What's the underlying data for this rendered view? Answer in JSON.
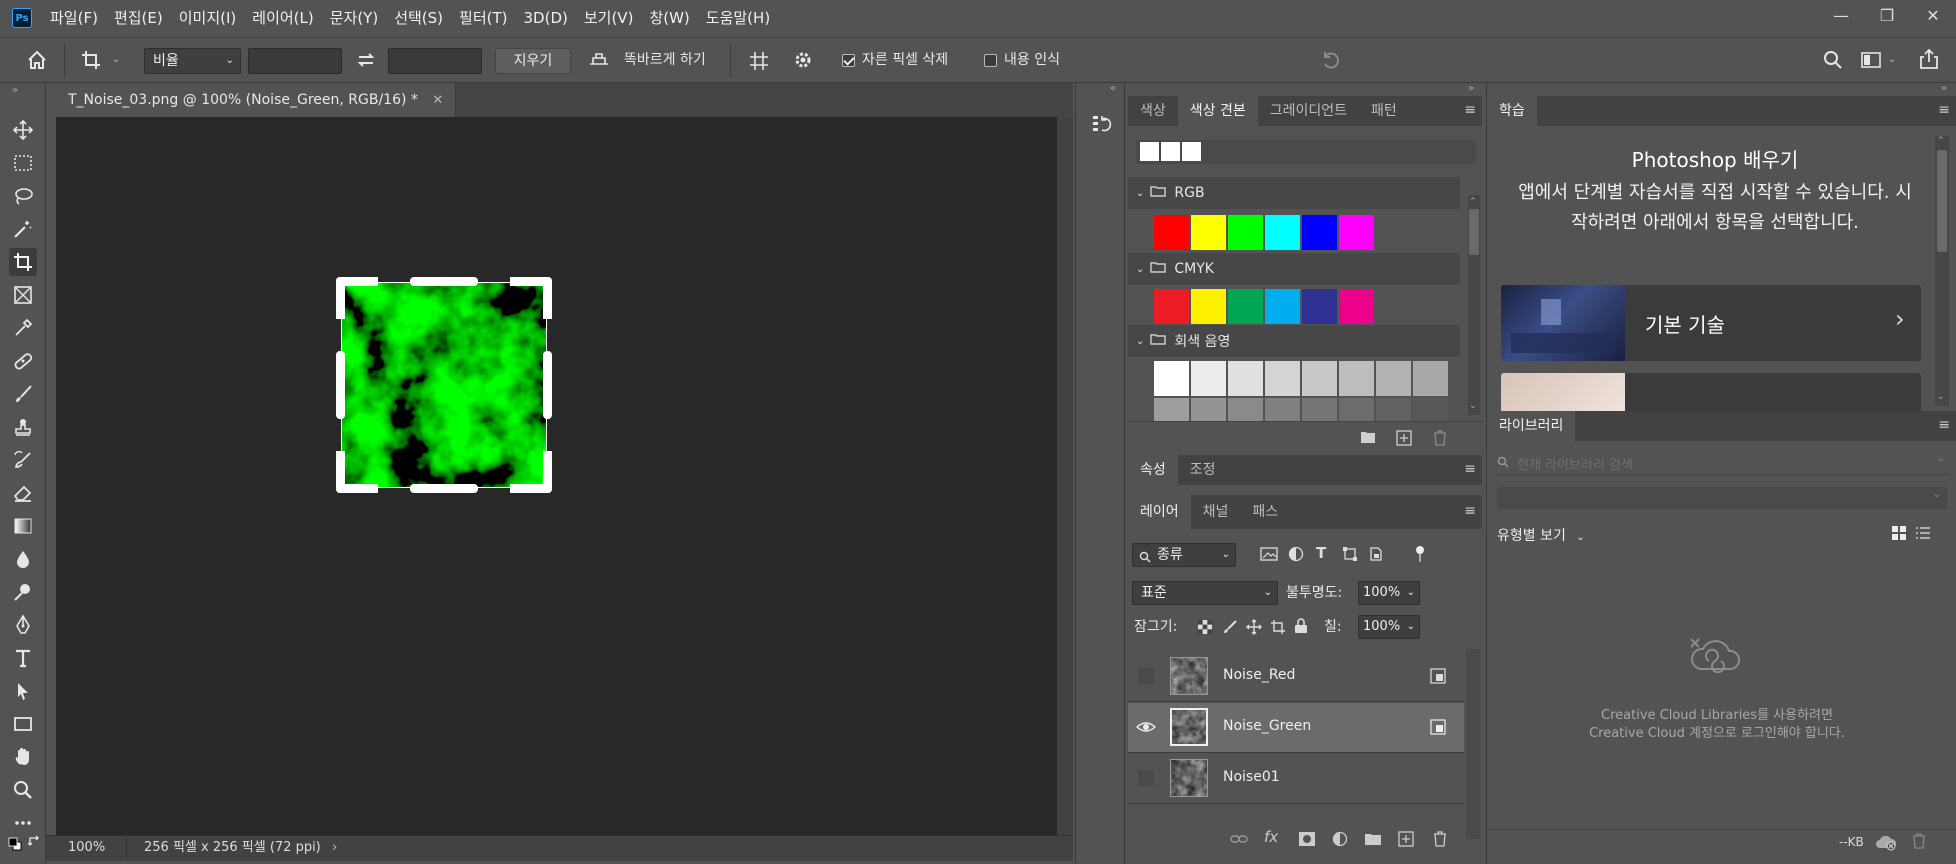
{
  "app": {
    "logo": "Ps"
  },
  "menu": [
    "파일(F)",
    "편집(E)",
    "이미지(I)",
    "레이어(L)",
    "문자(Y)",
    "선택(S)",
    "필터(T)",
    "3D(D)",
    "보기(V)",
    "창(W)",
    "도움말(H)"
  ],
  "window_controls": {
    "minimize": "—",
    "restore": "❐",
    "close": "✕"
  },
  "options": {
    "ratio_select": "비율",
    "clear_button": "지우기",
    "straighten_label": "똑바르게 하기",
    "delete_cropped_label": "자른 픽셀 삭제",
    "delete_cropped_checked": true,
    "content_aware_label": "내용 인식",
    "content_aware_checked": false
  },
  "document": {
    "tab_title": "T_Noise_03.png @ 100% (Noise_Green, RGB/16) *",
    "zoom": "100%",
    "info": "256 픽셀 x 256 픽셀 (72 ppi)"
  },
  "swatches_panel": {
    "tabs": [
      "색상",
      "색상 견본",
      "그레이디언트",
      "패턴"
    ],
    "active_tab": 1,
    "groups": {
      "rgb": {
        "name": "RGB",
        "colors": [
          "#ff0000",
          "#ffff00",
          "#00ff00",
          "#00ffff",
          "#0000ff",
          "#ff00ff"
        ]
      },
      "cmyk": {
        "name": "CMYK",
        "colors": [
          "#ed1c24",
          "#fff200",
          "#00a651",
          "#00aeef",
          "#2e3192",
          "#ec008c"
        ]
      },
      "gray": {
        "name": "회색 음영",
        "colors_row1": [
          "#ffffff",
          "#ececec",
          "#e0e0e0",
          "#d4d4d4",
          "#c8c8c8",
          "#bdbdbd",
          "#b2b2b2",
          "#a8a8a8"
        ],
        "colors_row2": [
          "#9e9e9e",
          "#949494",
          "#8a8a8a",
          "#808080",
          "#767676",
          "#6c6c6c",
          "#626262",
          "#585858"
        ]
      }
    }
  },
  "properties_panel": {
    "tabs": [
      "속성",
      "조정"
    ]
  },
  "layers_panel": {
    "tabs": [
      "레이어",
      "채널",
      "패스"
    ],
    "filter_kind": "종류",
    "blend_mode": "표준",
    "opacity_label": "불투명도:",
    "opacity_value": "100%",
    "lock_label": "잠그기:",
    "fill_label": "칠:",
    "fill_value": "100%",
    "layers": [
      {
        "name": "Noise_Red",
        "visible": false,
        "selected": false
      },
      {
        "name": "Noise_Green",
        "visible": true,
        "selected": true
      },
      {
        "name": "Noise01",
        "visible": false,
        "selected": false
      }
    ]
  },
  "learn_panel": {
    "tab": "학습",
    "title": "Photoshop 배우기",
    "description": "앱에서 단계별 자습서를 직접 시작할 수 있습니다. 시작하려면 아래에서 항목을 선택합니다.",
    "cards": [
      {
        "label": "기본 기술"
      }
    ]
  },
  "libraries_panel": {
    "tab": "라이브러리",
    "search_placeholder": "현재 라이브러리 검색",
    "view_by": "유형별 보기",
    "message": "Creative Cloud Libraries를 사용하려면 Creative Cloud 계정으로 로그인해야 합니다.",
    "size": "--KB"
  }
}
